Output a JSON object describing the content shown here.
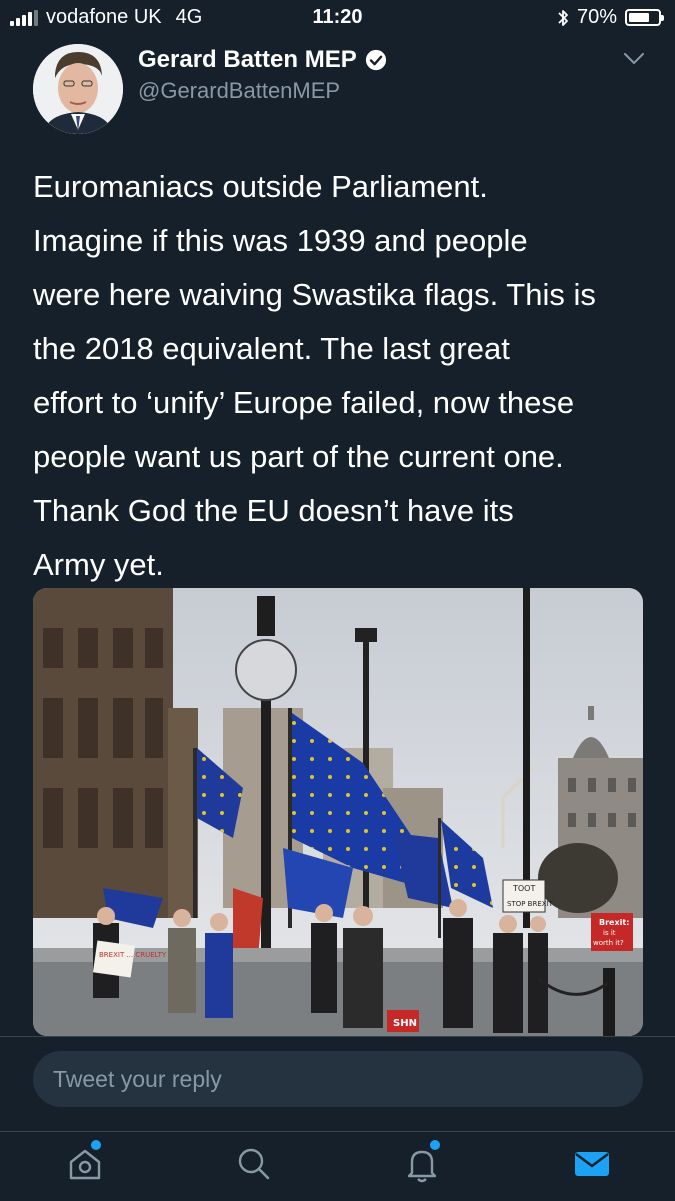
{
  "status_bar": {
    "carrier": "vodafone UK",
    "network": "4G",
    "time": "11:20",
    "battery_percent": "70%",
    "battery_level": 0.7,
    "icons": [
      "signal-icon",
      "bluetooth-icon",
      "battery-icon"
    ]
  },
  "tweet": {
    "author_name": "Gerard Batten MEP",
    "author_handle": "@GerardBattenMEP",
    "verified": true,
    "text": "Euromaniacs  outside Parliament.\nImagine if this was 1939 and people\nwere here waiving Swastika flags. This is\nthe 2018 equivalent. The last great\neffort to ‘unify’ Europe failed, now these\npeople want us part of the current one.\nThank God the EU doesn’t have its\nArmy yet.",
    "media": {
      "signs": {
        "left": "BREXIT ... CRUELTY",
        "toot": "TOOT",
        "stop_brexit": "STOP BREXIT",
        "right_line1": "Brexit:",
        "right_line2": "is it",
        "right_line3": "worth it?",
        "bottom": "SHN"
      }
    }
  },
  "reply": {
    "placeholder": "Tweet your reply"
  },
  "tabbar": {
    "items": [
      {
        "icon": "home-icon",
        "has_dot": true
      },
      {
        "icon": "search-icon",
        "has_dot": false
      },
      {
        "icon": "notifications-icon",
        "has_dot": true
      },
      {
        "icon": "messages-icon",
        "has_dot": false,
        "active": true
      }
    ]
  },
  "colors": {
    "background": "#15202b",
    "secondary_text": "#8899a6",
    "accent": "#1da1f2",
    "divider": "#38444d",
    "reply_field": "#253341"
  }
}
